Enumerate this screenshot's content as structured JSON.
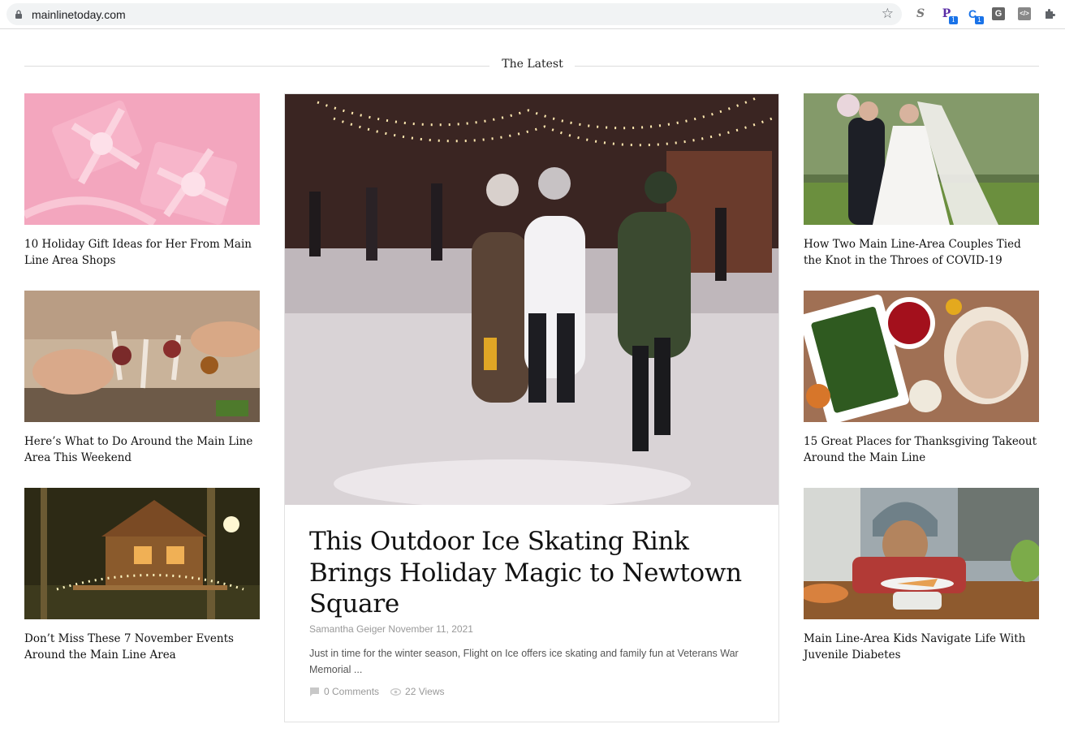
{
  "browser": {
    "url": "mainlinetoday.com",
    "extensions": [
      "S",
      "P",
      "C",
      "G",
      "</>"
    ],
    "extension_badges": [
      "1",
      "1"
    ]
  },
  "section": {
    "title": "The Latest"
  },
  "left_articles": [
    {
      "title": "10 Holiday Gift Ideas for Her From Main Line Area Shops"
    },
    {
      "title": "Here’s What to Do Around the Main Line Area This Weekend"
    },
    {
      "title": "Don’t Miss These 7 November Events Around the Main Line Area"
    }
  ],
  "right_articles": [
    {
      "title": "How Two Main Line-Area Couples Tied the Knot in the Throes of COVID-19"
    },
    {
      "title": "15 Great Places for Thanksgiving Takeout Around the Main Line"
    },
    {
      "title": "Main Line-Area Kids Navigate Life With Juvenile Diabetes"
    }
  ],
  "feature": {
    "headline": "This Outdoor Ice Skating Rink Brings Holiday Magic to Newtown Square",
    "author": "Samantha Geiger",
    "date": "November 11, 2021",
    "excerpt": "Just in time for the winter season, Flight on Ice offers ice skating and family fun at Veterans War Memorial ...",
    "comments": "0 Comments",
    "views": "22 Views"
  }
}
